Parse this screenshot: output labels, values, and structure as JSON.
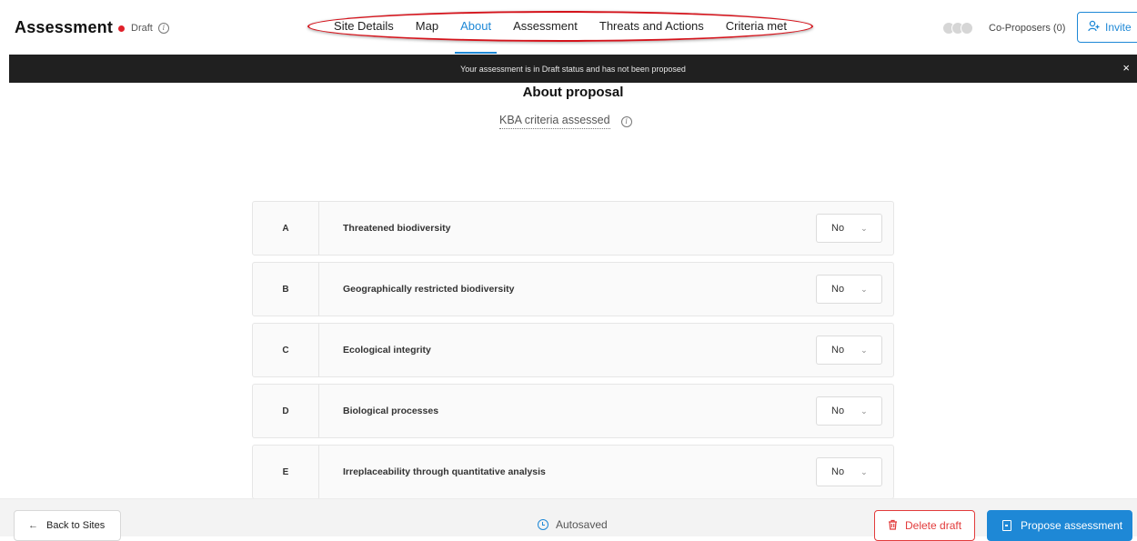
{
  "header": {
    "title": "Assessment",
    "status_label": "Draft",
    "co_proposers_label": "Co-Proposers (0)",
    "invite_label": "Invite"
  },
  "nav": {
    "tabs": [
      {
        "label": "Site Details",
        "active": false
      },
      {
        "label": "Map",
        "active": false
      },
      {
        "label": "About",
        "active": true
      },
      {
        "label": "Assessment",
        "active": false
      },
      {
        "label": "Threats and Actions",
        "active": false
      },
      {
        "label": "Criteria met",
        "active": false
      }
    ]
  },
  "banner": {
    "message": "Your assessment is in Draft status and has not been proposed",
    "close_glyph": "×"
  },
  "main": {
    "title": "About proposal",
    "subtitle": "KBA criteria assessed",
    "criteria": [
      {
        "letter": "A",
        "label": "Threatened biodiversity",
        "value": "No"
      },
      {
        "letter": "B",
        "label": "Geographically restricted biodiversity",
        "value": "No"
      },
      {
        "letter": "C",
        "label": "Ecological integrity",
        "value": "No"
      },
      {
        "letter": "D",
        "label": "Biological processes",
        "value": "No"
      },
      {
        "letter": "E",
        "label": "Irreplaceability through quantitative analysis",
        "value": "No"
      }
    ]
  },
  "footer": {
    "back_label": "Back to Sites",
    "autosaved_label": "Autosaved",
    "delete_label": "Delete draft",
    "propose_label": "Propose assessment"
  },
  "icons": {
    "info": "info-icon",
    "invite": "user-plus-icon",
    "close": "close-icon",
    "chevron": "chevron-down-icon",
    "back": "arrow-left-icon",
    "clock": "clock-icon",
    "trash": "trash-icon",
    "document": "document-icon"
  },
  "colors": {
    "accent": "#1e88d6",
    "danger": "#e23b3b",
    "status_dot": "#e0202a",
    "banner_bg": "#202020",
    "annotation_oval": "#d4141c"
  }
}
